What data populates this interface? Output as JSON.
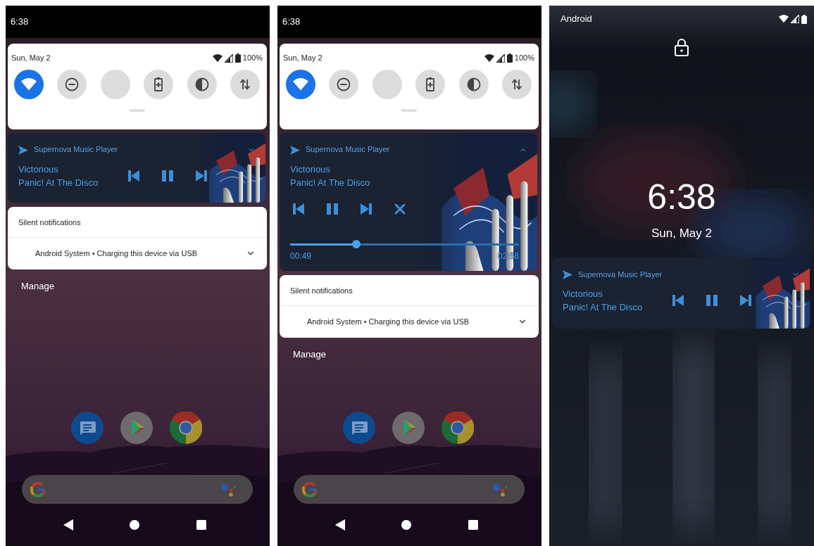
{
  "screens": [
    {
      "kind": "shade",
      "status_time": "6:38",
      "quick_settings": {
        "date": "Sun, May 2",
        "battery": "100%",
        "tiles": [
          {
            "kind": "wifi",
            "on": true
          },
          {
            "kind": "dnd",
            "on": false
          },
          {
            "kind": "blank",
            "on": false
          },
          {
            "kind": "battery-saver",
            "on": false
          },
          {
            "kind": "invert",
            "on": false
          },
          {
            "kind": "data",
            "on": false
          }
        ]
      },
      "media": {
        "app": "Supernova Music Player",
        "title": "Victorious",
        "artist": "Panic! At The Disco",
        "expanded": false,
        "controls": [
          {
            "kind": "previous"
          },
          {
            "kind": "pause"
          },
          {
            "kind": "next"
          }
        ]
      },
      "silent": {
        "header": "Silent notifications",
        "item": "Android System • Charging this device via USB",
        "expanded": false
      },
      "manage": "Manage"
    },
    {
      "kind": "shade",
      "status_time": "6:38",
      "quick_settings": {
        "date": "Sun, May 2",
        "battery": "100%",
        "tiles": [
          {
            "kind": "wifi",
            "on": true
          },
          {
            "kind": "dnd",
            "on": false
          },
          {
            "kind": "blank",
            "on": false
          },
          {
            "kind": "battery-saver",
            "on": false
          },
          {
            "kind": "invert",
            "on": false
          },
          {
            "kind": "data",
            "on": false
          }
        ]
      },
      "media": {
        "app": "Supernova Music Player",
        "title": "Victorious",
        "artist": "Panic! At The Disco",
        "expanded": true,
        "controls": [
          {
            "kind": "previous"
          },
          {
            "kind": "pause"
          },
          {
            "kind": "next"
          },
          {
            "kind": "close"
          }
        ],
        "progress": {
          "level": 0.28,
          "elapsed": "00:49",
          "duration": "02:58"
        }
      },
      "silent": {
        "header": "Silent notifications",
        "item": "Android System • Charging this device via USB",
        "expanded": false
      },
      "manage": "Manage"
    },
    {
      "kind": "lock",
      "carrier": "Android",
      "clock": "6:38",
      "date": "Sun, May 2",
      "media": {
        "app": "Supernova Music Player",
        "title": "Victorious",
        "artist": "Panic! At The Disco",
        "expanded": false,
        "controls": [
          {
            "kind": "previous"
          },
          {
            "kind": "pause"
          },
          {
            "kind": "next"
          }
        ]
      }
    }
  ]
}
